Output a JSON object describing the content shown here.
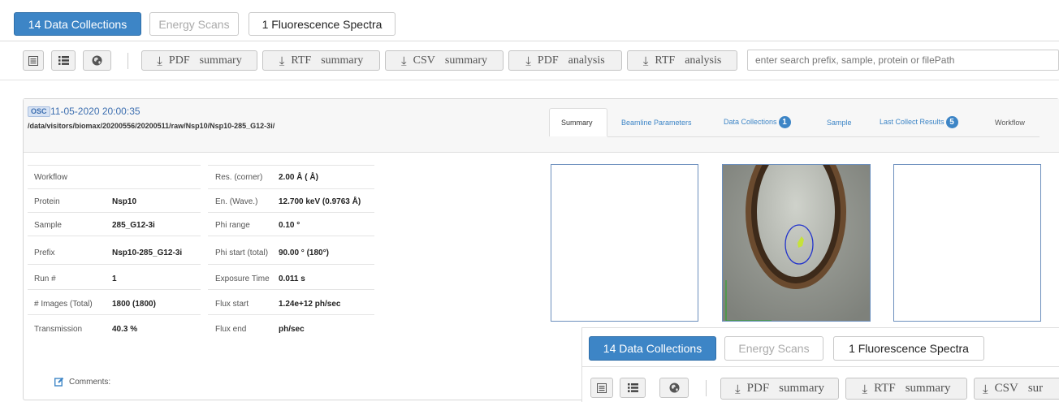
{
  "top_tabs": [
    {
      "label": "14 Data Collections",
      "state": "active"
    },
    {
      "label": "Energy Scans",
      "state": "disabled"
    },
    {
      "label": "1 Fluorescence Spectra",
      "state": "normal"
    }
  ],
  "toolbar": {
    "view_icons": [
      "list-detail-icon",
      "list-icon",
      "globe-icon"
    ],
    "exports": [
      {
        "w1": "PDF",
        "w2": "summary"
      },
      {
        "w1": "RTF",
        "w2": "summary"
      },
      {
        "w1": "CSV",
        "w2": "summary"
      },
      {
        "w1": "PDF",
        "w2": "analysis"
      },
      {
        "w1": "RTF",
        "w2": "analysis"
      }
    ],
    "search_placeholder": "enter search prefix, sample, protein or filePath"
  },
  "collection": {
    "badge": "OSC",
    "datetime": "11-05-2020 20:00:35",
    "path": "/data/visitors/biomax/20200556/20200511/raw/Nsp10/Nsp10-285_G12-3i/",
    "tabs": [
      {
        "label": "Summary",
        "badge": ""
      },
      {
        "label": "Beamline Parameters",
        "badge": ""
      },
      {
        "label": "Data Collections",
        "badge": "1"
      },
      {
        "label": "Sample",
        "badge": ""
      },
      {
        "label": "Last Collect Results",
        "badge": "5"
      },
      {
        "label": "Workflow",
        "badge": ""
      }
    ],
    "left_table": [
      {
        "label": "Workflow",
        "value": ""
      },
      {
        "label": "Protein",
        "value": "Nsp10"
      },
      {
        "label": "Sample",
        "value": "285_G12-3i"
      },
      {
        "label": "Prefix",
        "value": "Nsp10-285_G12-3i"
      },
      {
        "label": "Run #",
        "value": "1"
      },
      {
        "label": "# Images (Total)",
        "value": "1800 (1800)"
      },
      {
        "label": "Transmission",
        "value": "40.3 %"
      }
    ],
    "right_table": [
      {
        "label": "Res. (corner)",
        "value": "2.00 Å ( Å)"
      },
      {
        "label": "En. (Wave.)",
        "value": "12.700 keV (0.9763 Å)"
      },
      {
        "label": "Phi range",
        "value": "0.10 °"
      },
      {
        "label": "Phi start (total)",
        "value": "90.00 ° (180°)"
      },
      {
        "label": "Exposure Time",
        "value": "0.011 s"
      },
      {
        "label": "Flux start",
        "value": "1.24e+12 ph/sec"
      },
      {
        "label": "Flux end",
        "value": "ph/sec"
      }
    ],
    "comments_label": "Comments:"
  },
  "overlay": {
    "tabs": [
      {
        "label": "14 Data Collections",
        "state": "active"
      },
      {
        "label": "Energy Scans",
        "state": "disabled"
      },
      {
        "label": "1 Fluorescence Spectra",
        "state": "normal"
      }
    ],
    "exports": [
      {
        "w1": "PDF",
        "w2": "summary"
      },
      {
        "w1": "RTF",
        "w2": "summary"
      },
      {
        "w1": "CSV",
        "w2": "sur"
      }
    ]
  },
  "colors": {
    "accent": "#3d85c6",
    "border": "#c9c9c9",
    "image_border": "#6c8fbd"
  }
}
